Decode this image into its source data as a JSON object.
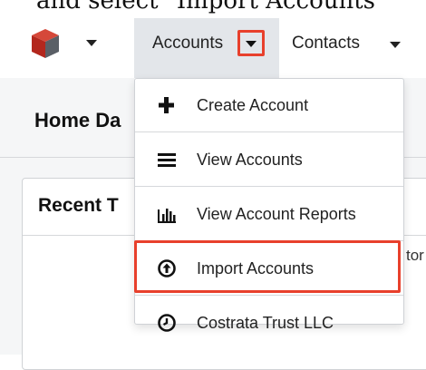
{
  "instruction_text": "and select \"Import Accounts\"",
  "nav": {
    "accounts_label": "Accounts",
    "contacts_label": "Contacts"
  },
  "page": {
    "title": "Home Da",
    "dashlet_title": "Recent T",
    "peek_text": "tor"
  },
  "menu": {
    "items": [
      {
        "label": "Create Account",
        "icon": "plus-icon"
      },
      {
        "label": "View Accounts",
        "icon": "list-icon"
      },
      {
        "label": "View Account Reports",
        "icon": "bar-chart-icon"
      },
      {
        "label": "Import Accounts",
        "icon": "import-icon"
      },
      {
        "label": "Costrata Trust LLC",
        "icon": "clock-icon"
      }
    ]
  },
  "colors": {
    "highlight": "#e8402c",
    "nav_active_bg": "#e3e6ea",
    "logo_red": "#c0392b"
  }
}
